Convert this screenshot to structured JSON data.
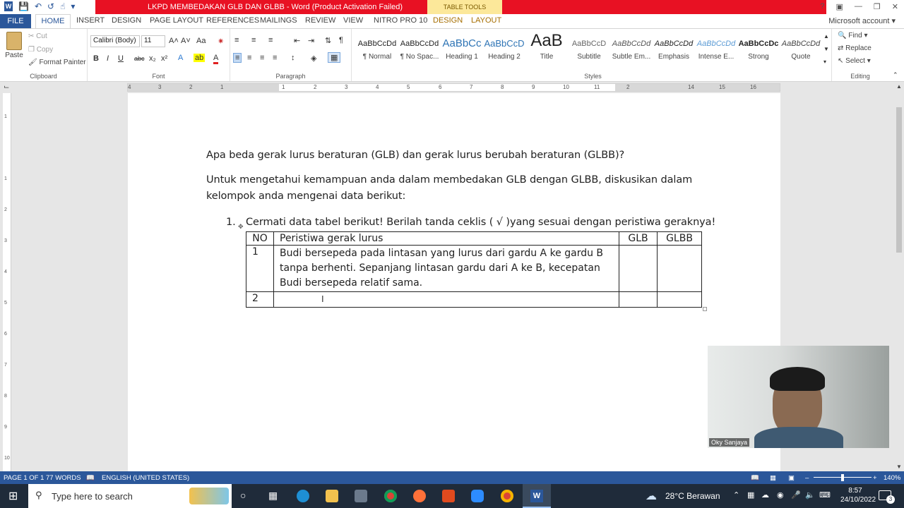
{
  "window": {
    "title": "LKPD MEMBEDAKAN GLB DAN GLBB - Word (Product Activation Failed)",
    "context_tab_group": "TABLE TOOLS",
    "account": "Microsoft account"
  },
  "tabs": {
    "file": "FILE",
    "home": "HOME",
    "insert": "INSERT",
    "design": "DESIGN",
    "page_layout": "PAGE LAYOUT",
    "references": "REFERENCES",
    "mailings": "MAILINGS",
    "review": "REVIEW",
    "view": "VIEW",
    "nitro": "NITRO PRO 10",
    "tt_design": "DESIGN",
    "tt_layout": "LAYOUT"
  },
  "clipboard": {
    "paste": "Paste",
    "cut": "Cut",
    "copy": "Copy",
    "format_painter": "Format Painter",
    "label": "Clipboard"
  },
  "font": {
    "name": "Calibri (Body)",
    "size": "11",
    "label": "Font",
    "bold": "B",
    "italic": "I",
    "underline": "U",
    "strike": "abc",
    "sub": "x₂",
    "sup": "x²",
    "grow": "A˄",
    "shrink": "A˅",
    "case": "Aa",
    "color_a": "A",
    "effects_a": "A"
  },
  "paragraph": {
    "label": "Paragraph"
  },
  "styles": {
    "label": "Styles",
    "items": [
      {
        "preview": "AaBbCcDd",
        "name": "¶ Normal"
      },
      {
        "preview": "AaBbCcDd",
        "name": "¶ No Spac..."
      },
      {
        "preview": "AaBbCc",
        "name": "Heading 1"
      },
      {
        "preview": "AaBbCcD",
        "name": "Heading 2"
      },
      {
        "preview": "AaB",
        "name": "Title"
      },
      {
        "preview": "AaBbCcD",
        "name": "Subtitle"
      },
      {
        "preview": "AaBbCcDd",
        "name": "Subtle Em..."
      },
      {
        "preview": "AaBbCcDd",
        "name": "Emphasis"
      },
      {
        "preview": "AaBbCcDd",
        "name": "Intense E..."
      },
      {
        "preview": "AaBbCcDc",
        "name": "Strong"
      },
      {
        "preview": "AaBbCcDd",
        "name": "Quote"
      }
    ]
  },
  "editing": {
    "label": "Editing",
    "find": "Find",
    "replace": "Replace",
    "select": "Select"
  },
  "ruler": {
    "h": [
      "4",
      "3",
      "2",
      "1",
      "1",
      "2",
      "3",
      "4",
      "5",
      "6",
      "7",
      "8",
      "9",
      "10",
      "11",
      "2",
      "14",
      "15",
      "16"
    ],
    "v": [
      "1",
      "1",
      "2",
      "3",
      "4",
      "5",
      "6",
      "7",
      "8",
      "9",
      "10"
    ]
  },
  "document": {
    "q1": "Apa beda gerak lurus beraturan (GLB) dan gerak lurus berubah beraturan (GLBB)?",
    "p2a": "Untuk mengetahui kemampuan anda dalam membedakan GLB dengan GLBB, diskusikan dalam",
    "p2b": "kelompok anda mengenai data berikut:",
    "li_num": "1.",
    "li_text": "Cermati data tabel berikut! Berilah tanda ceklis ( √ )yang sesuai dengan peristiwa geraknya!",
    "table": {
      "headers": [
        "NO",
        "Peristiwa gerak lurus",
        "GLB",
        "GLBB"
      ],
      "rows": [
        {
          "no": "1",
          "text_lines": [
            "Budi bersepeda pada lintasan yang lurus dari gardu A ke gardu B",
            "tanpa berhenti. Sepanjang lintasan gardu dari A ke B, kecepatan",
            "Budi bersepeda relatif sama."
          ]
        },
        {
          "no": "2",
          "text_lines": [
            ""
          ]
        }
      ]
    }
  },
  "webcam": {
    "name": "Oky Sanjaya"
  },
  "status": {
    "page": "PAGE 1 OF 1",
    "words": "77 WORDS",
    "lang": "ENGLISH (UNITED STATES)",
    "zoom": "140%"
  },
  "taskbar": {
    "search_placeholder": "Type here to search",
    "weather": "28°C Berawan",
    "time": "8:57",
    "date": "24/10/2022",
    "notif_count": "3"
  },
  "colors": {
    "word_blue": "#2b579a",
    "title_red": "#e81123",
    "taskbar": "#1f2b3a"
  }
}
